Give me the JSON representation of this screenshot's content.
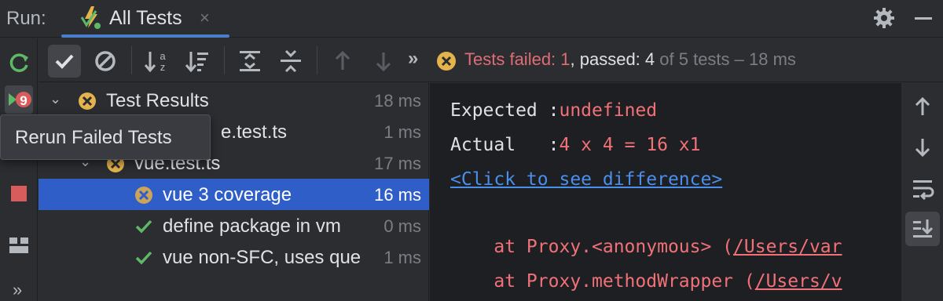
{
  "titlebar": {
    "run_label": "Run:",
    "tab_label": "All Tests",
    "tab_close": "×"
  },
  "tooltip": "Rerun Failed Tests",
  "toolbar": {
    "more": "»",
    "status_failed": "Tests failed: 1",
    "status_passed": ", passed: 4",
    "status_total": " of 5 tests – 18 ms"
  },
  "tree": [
    {
      "label": "Test Results",
      "time": "18 ms",
      "status": "fail",
      "caret": "⌄",
      "indent": 0
    },
    {
      "label": "e.test.ts",
      "time": "1 ms",
      "status": "none",
      "caret": "",
      "indent": 1
    },
    {
      "label": "vue.test.ts",
      "time": "17 ms",
      "status": "fail",
      "caret": "⌄",
      "indent": 1
    },
    {
      "label": "vue 3 coverage",
      "time": "16 ms",
      "status": "fail",
      "caret": "",
      "indent": 2,
      "selected": true
    },
    {
      "label": "define package in vm",
      "time": "0 ms",
      "status": "pass",
      "caret": "",
      "indent": 2
    },
    {
      "label": "vue non-SFC, uses que",
      "time": "1 ms",
      "status": "pass",
      "caret": "",
      "indent": 2
    }
  ],
  "console": {
    "expected_label": "Expected :",
    "expected_value": "undefined",
    "actual_label": "Actual   :",
    "actual_value": "4 x 4 = 16 x1",
    "diff_link": "<Click to see difference>",
    "stack1_prefix": "    at Proxy.<anonymous> (",
    "stack1_link": "/Users/var",
    "stack2_prefix": "    at Proxy.methodWrapper (",
    "stack2_link": "/Users/v"
  },
  "leftbar": {
    "more": "»"
  },
  "colors": {
    "fail": "#e5b34b",
    "pass": "#5fb865",
    "accent": "#2f5ec8",
    "error_text": "#f07178"
  }
}
